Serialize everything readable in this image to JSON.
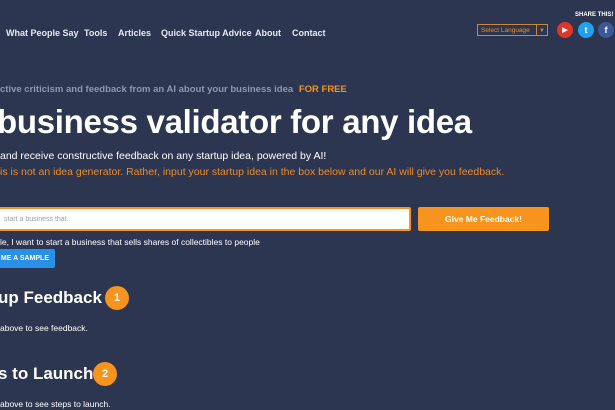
{
  "nav": {
    "items": [
      "What People Say",
      "Tools",
      "Articles",
      "Quick Startup Advice",
      "About",
      "Contact"
    ]
  },
  "share": {
    "label": "SHARE THIS!",
    "youtube": "▶",
    "twitter": "t",
    "facebook": "f"
  },
  "language": {
    "selected": "Select Language",
    "arrow": "▼"
  },
  "header": {
    "subheadline": "ctive criticism and feedback from an AI about your business idea",
    "free_label": "FOR FREE",
    "title": "business validator for any idea",
    "description": "and receive constructive feedback on any startup idea, powered by AI!",
    "note": "is is not an idea generator. Rather, input your startup idea in the box below and our AI will give you feedback."
  },
  "form": {
    "placeholder": "start a business that..",
    "submit_label": "Give Me Feedback!",
    "example_text": "le, I want to start a business that sells shares of collectibles to people",
    "sample_button_label": "ME A SAMPLE"
  },
  "sections": [
    {
      "title": "up Feedback",
      "number": "1",
      "hint": "above to see feedback."
    },
    {
      "title": "s to Launch",
      "number": "2",
      "hint": "above to see steps to launch."
    }
  ]
}
